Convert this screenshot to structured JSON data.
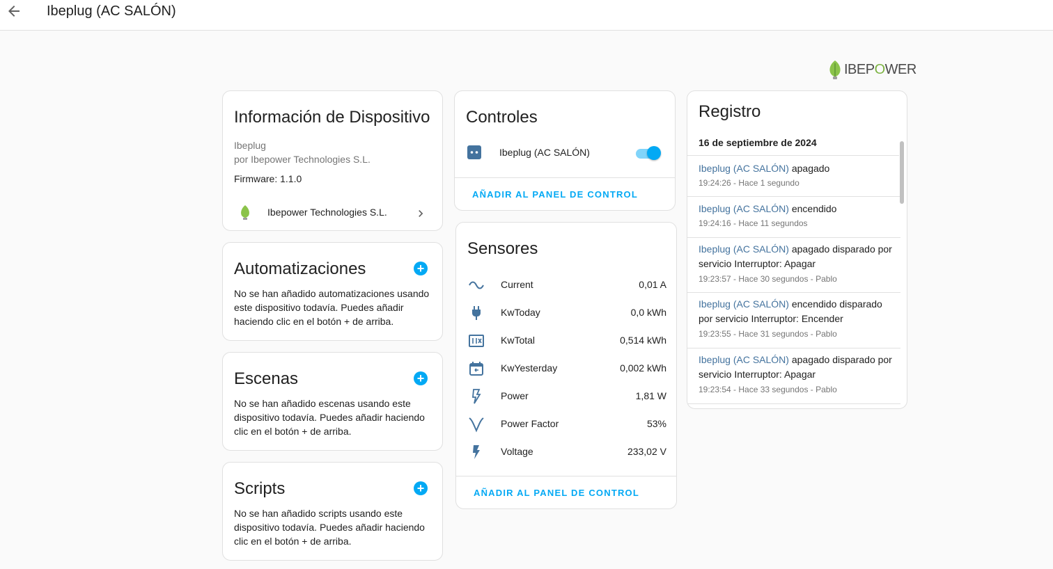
{
  "header": {
    "title": "Ibeplug (AC SALÓN)",
    "back_icon": "arrow-left-icon"
  },
  "logo": {
    "text_main": "IBEP",
    "text_o": "O",
    "text_end": "WER"
  },
  "device_info": {
    "title": "Información de Dispositivo",
    "model": "Ibeplug",
    "manufacturer": "por Ibepower Technologies S.L.",
    "firmware": "Firmware: 1.1.0",
    "integration": "Ibepower Technologies S.L."
  },
  "automations": {
    "title": "Automatizaciones",
    "text": "No se han añadido automatizaciones usando este dispositivo todavía. Puedes añadir haciendo clic en el botón + de arriba."
  },
  "scenes": {
    "title": "Escenas",
    "text": "No se han añadido escenas usando este dispositivo todavía. Puedes añadir haciendo clic en el botón + de arriba."
  },
  "scripts": {
    "title": "Scripts",
    "text": "No se han añadido scripts usando este dispositivo todavía. Puedes añadir haciendo clic en el botón + de arriba."
  },
  "controls": {
    "title": "Controles",
    "entity": "Ibeplug (AC SALÓN)",
    "toggle_on": true,
    "action": "AÑADIR AL PANEL DE CONTROL"
  },
  "sensors": {
    "title": "Sensores",
    "rows": [
      {
        "label": "Current",
        "value": "0,01 A",
        "icon": "current-ac-icon"
      },
      {
        "label": "KwToday",
        "value": "0,0 kWh",
        "icon": "power-plug-icon"
      },
      {
        "label": "KwTotal",
        "value": "0,514 kWh",
        "icon": "counter-icon"
      },
      {
        "label": "KwYesterday",
        "value": "0,002 kWh",
        "icon": "calendar-icon"
      },
      {
        "label": "Power",
        "value": "1,81 W",
        "icon": "flash-outline-icon"
      },
      {
        "label": "Power Factor",
        "value": "53%",
        "icon": "angle-acute-icon"
      },
      {
        "label": "Voltage",
        "value": "233,02 V",
        "icon": "flash-icon"
      }
    ],
    "action": "AÑADIR AL PANEL DE CONTROL"
  },
  "logbook": {
    "title": "Registro",
    "date": "16 de septiembre de 2024",
    "entries": [
      {
        "entity": "Ibeplug (AC SALÓN)",
        "text1": " apagado",
        "text2": "",
        "meta": "19:24:26 - Hace 1 segundo"
      },
      {
        "entity": "Ibeplug (AC SALÓN)",
        "text1": " encendido",
        "text2": "",
        "meta": "19:24:16 - Hace 11 segundos"
      },
      {
        "entity": "Ibeplug (AC SALÓN)",
        "text1": " apagado disparado por",
        "text2": "servicio Interruptor: Apagar",
        "meta": "19:23:57 - Hace 30 segundos - Pablo"
      },
      {
        "entity": "Ibeplug (AC SALÓN)",
        "text1": " encendido disparado",
        "text2": "por servicio Interruptor: Encender",
        "meta": "19:23:55 - Hace 31 segundos - Pablo"
      },
      {
        "entity": "Ibeplug (AC SALÓN)",
        "text1": " apagado disparado por",
        "text2": "servicio Interruptor: Apagar",
        "meta": "19:23:54 - Hace 33 segundos - Pablo"
      }
    ]
  }
}
